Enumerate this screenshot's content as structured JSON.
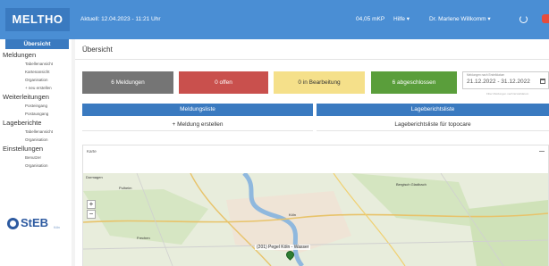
{
  "app": {
    "brand": "MELTHO",
    "last_update": "Aktuell: 12.04.2023 - 11:21 Uhr",
    "level": "04,05 mKP",
    "help": "Hilfe ▾",
    "user": "Dr. Marlene Willkomm ▾"
  },
  "sidebar": {
    "active": "Übersicht",
    "sections": [
      {
        "title": "Meldungen",
        "items": [
          "Tabellenansicht",
          "Kartenansicht",
          "Organisation",
          "+ neu erstellen"
        ]
      },
      {
        "title": "Weiterleitungen",
        "items": [
          "Posteingang",
          "Postausgang"
        ]
      },
      {
        "title": "Lageberichte",
        "items": [
          "Tabellenansicht",
          "Organisation"
        ]
      },
      {
        "title": "Einstellungen",
        "items": [
          "Benutzer",
          "Organisation"
        ]
      }
    ],
    "logo": {
      "text": "StEB",
      "sub": "Köln"
    }
  },
  "page": {
    "title": "Übersicht"
  },
  "status": {
    "reports": "6 Meldungen",
    "open": "0 offen",
    "in_progress": "0 in Bearbeitung",
    "closed": "6 abgeschlossen"
  },
  "date_filter": {
    "label": "Meldungen nach Erstelldatum",
    "value": "21.12.2022 - 31.12.2022",
    "note": "Filter Meldungen nach Erstelldatum"
  },
  "buttons": {
    "report_list": "Meldungsliste",
    "situation_list": "Lageberichtsliste",
    "new_report": "+ Meldung erstellen",
    "topocare_list": "Lageberichtsliste für topocare"
  },
  "map_card": {
    "title": "Karte",
    "labels": [
      "Dormagen",
      "Pulheim",
      "Bergisch Gladbach",
      "Frechen",
      "Köln"
    ],
    "marker_label": "(201) Pegel Köln - Wasser"
  },
  "colors": {
    "topbar": "#4a8ed4",
    "primary": "#3a7ac0",
    "gray": "#757575",
    "red": "#c9504d",
    "yellow": "#f5e08a",
    "green": "#5a9e3b"
  }
}
